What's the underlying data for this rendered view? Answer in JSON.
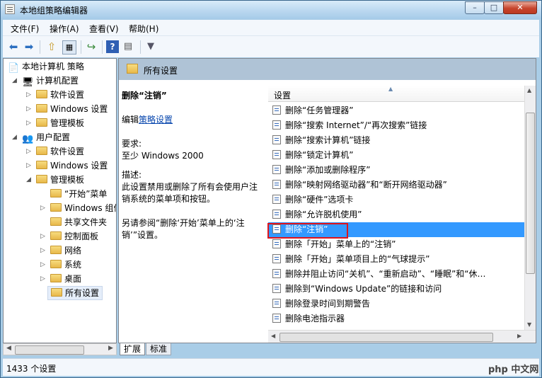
{
  "window": {
    "title": "本地组策略编辑器",
    "btn_min": "–",
    "btn_max": "□",
    "btn_close": "✕"
  },
  "menu": [
    "文件(F)",
    "操作(A)",
    "查看(V)",
    "帮助(H)"
  ],
  "toolbar": {
    "icons": [
      "back-arrow-icon",
      "forward-arrow-icon",
      "up-folder-icon",
      "show-hide-tree-icon",
      "export-list-icon",
      "help-icon",
      "properties-icon",
      "filter-icon"
    ]
  },
  "tree": {
    "root": "本地计算机 策略",
    "computer_config": "计算机配置",
    "cc_items": [
      "软件设置",
      "Windows 设置",
      "管理模板"
    ],
    "user_config": "用户配置",
    "uc_items": [
      "软件设置",
      "Windows 设置",
      "管理模板"
    ],
    "admin_templates_children": [
      "“开始”菜单",
      "Windows 组件",
      "共享文件夹",
      "控制面板",
      "网络",
      "系统",
      "桌面",
      "所有设置"
    ]
  },
  "right": {
    "header": "所有设置",
    "desc_title": "删除“注销”",
    "edit_prefix": "编辑",
    "edit_link": "策略设置",
    "requirements_label": "要求:",
    "requirements_value": "至少 Windows 2000",
    "description_label": "描述:",
    "description_text": "此设置禁用或删除了所有会使用户注销系统的菜单项和按钮。",
    "see_also": "另请参阅“删除‘开始’菜单上的‘注销’”设置。",
    "list_header": "设置",
    "list_items": [
      "删除“任务管理器”",
      "删除“搜索 Internet”/“再次搜索”链接",
      "删除“搜索计算机”链接",
      "删除“锁定计算机”",
      "删除“添加或删除程序”",
      "删除“映射网络驱动器”和“断开网络驱动器”",
      "删除“硬件”选项卡",
      "删除“允许脱机使用”",
      "删除“注销”",
      "删除「开始」菜单上的“注销”",
      "删除「开始」菜单项目上的“气球提示”",
      "删除并阻止访问“关机”、“重新启动”、“睡眠”和“休…",
      "删除到“Windows Update”的链接和访问",
      "删除登录时间到期警告",
      "删除电池指示器"
    ],
    "selected_index": 8
  },
  "tabs": [
    "扩展",
    "标准"
  ],
  "status": "1433 个设置",
  "watermark": "php 中文网"
}
